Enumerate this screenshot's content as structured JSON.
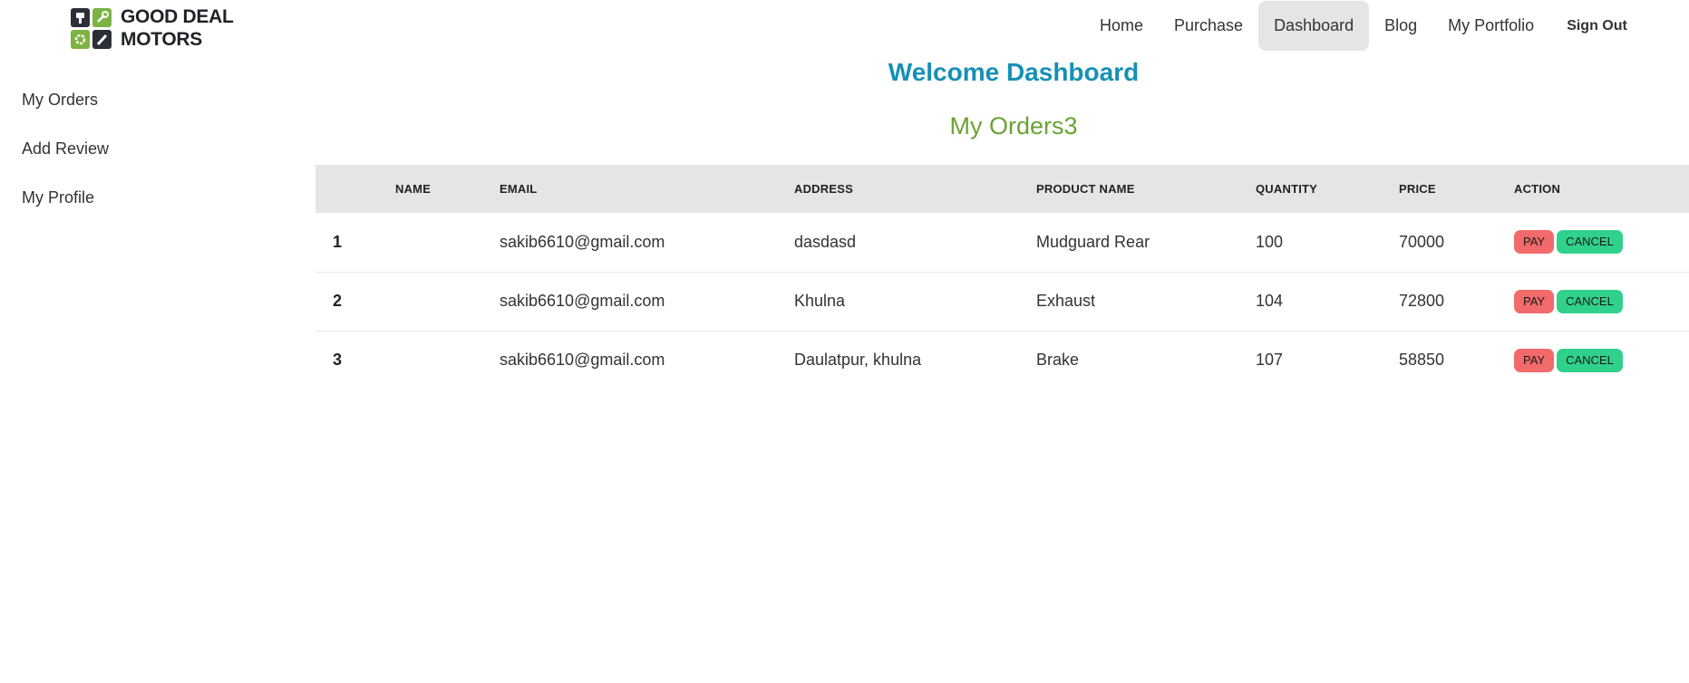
{
  "brand": {
    "line1": "GOOD DEAL",
    "line2": "MOTORS"
  },
  "nav": {
    "items": [
      {
        "label": "Home"
      },
      {
        "label": "Purchase"
      },
      {
        "label": "Dashboard",
        "active": true
      },
      {
        "label": "Blog"
      },
      {
        "label": "My Portfolio"
      }
    ],
    "signout_label": "Sign Out"
  },
  "sidebar": {
    "items": [
      {
        "label": "My Orders"
      },
      {
        "label": "Add Review"
      },
      {
        "label": "My Profile"
      }
    ]
  },
  "main": {
    "title": "Welcome Dashboard",
    "subtitle": "My Orders3"
  },
  "table": {
    "headers": [
      "",
      "NAME",
      "EMAIL",
      "ADDRESS",
      "PRODUCT NAME",
      "QUANTITY",
      "PRICE",
      "ACTION"
    ],
    "rows": [
      {
        "index": "1",
        "name": "",
        "email": "sakib6610@gmail.com",
        "address": "dasdasd",
        "product": "Mudguard Rear",
        "quantity": "100",
        "price": "70000"
      },
      {
        "index": "2",
        "name": "",
        "email": "sakib6610@gmail.com",
        "address": "Khulna",
        "product": "Exhaust",
        "quantity": "104",
        "price": "72800"
      },
      {
        "index": "3",
        "name": "",
        "email": "sakib6610@gmail.com",
        "address": "Daulatpur, khulna",
        "product": "Brake",
        "quantity": "107",
        "price": "58850"
      }
    ],
    "pay_label": "PAY",
    "cancel_label": "CANCEL"
  },
  "colors": {
    "title": "#1690b6",
    "subtitle": "#6aa233",
    "pay": "#f26a6a",
    "cancel": "#2fd18b",
    "header_bg": "#e5e5e5"
  }
}
